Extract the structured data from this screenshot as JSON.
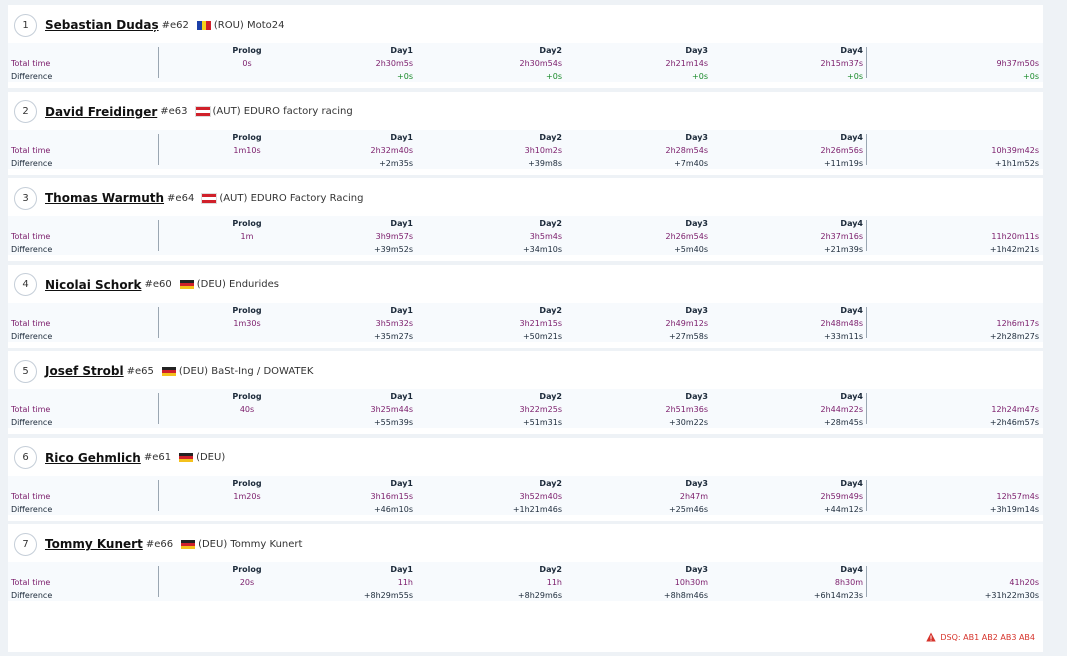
{
  "columns": {
    "prolog": "Prolog",
    "day1": "Day1",
    "day2": "Day2",
    "day3": "Day3",
    "day4": "Day4"
  },
  "row_labels": {
    "total": "Total time",
    "difference": "Difference"
  },
  "flags": {
    "ROU": {
      "dir": "v",
      "colors": [
        "#1c3fa8",
        "#f4d21c",
        "#d0202a"
      ]
    },
    "AUT": {
      "dir": "h",
      "colors": [
        "#d0202a",
        "#ffffff",
        "#d0202a"
      ]
    },
    "DEU": {
      "dir": "h",
      "colors": [
        "#222222",
        "#d0202a",
        "#f4c11c"
      ]
    }
  },
  "riders": [
    {
      "pos": "1",
      "name": "Sebastian Dudaș",
      "num": "#e62",
      "flag": "ROU",
      "team": "(ROU) Moto24",
      "total": {
        "prolog": "0s",
        "day1": "2h30m5s",
        "day2": "2h30m54s",
        "day3": "2h21m14s",
        "day4": "2h15m37s",
        "final": "9h37m50s"
      },
      "diff": {
        "prolog": "",
        "day1": "+0s",
        "day2": "+0s",
        "day3": "+0s",
        "day4": "+0s",
        "final": "+0s"
      }
    },
    {
      "pos": "2",
      "name": "David Freidinger",
      "num": "#e63",
      "flag": "AUT",
      "team": "(AUT) EDURO factory racing",
      "total": {
        "prolog": "1m10s",
        "day1": "2h32m40s",
        "day2": "3h10m2s",
        "day3": "2h28m54s",
        "day4": "2h26m56s",
        "final": "10h39m42s"
      },
      "diff": {
        "prolog": "",
        "day1": "+2m35s",
        "day2": "+39m8s",
        "day3": "+7m40s",
        "day4": "+11m19s",
        "final": "+1h1m52s"
      }
    },
    {
      "pos": "3",
      "name": "Thomas Warmuth",
      "num": "#e64",
      "flag": "AUT",
      "team": "(AUT) EDURO Factory Racing",
      "total": {
        "prolog": "1m",
        "day1": "3h9m57s",
        "day2": "3h5m4s",
        "day3": "2h26m54s",
        "day4": "2h37m16s",
        "final": "11h20m11s"
      },
      "diff": {
        "prolog": "",
        "day1": "+39m52s",
        "day2": "+34m10s",
        "day3": "+5m40s",
        "day4": "+21m39s",
        "final": "+1h42m21s"
      }
    },
    {
      "pos": "4",
      "name": "Nicolai Schork",
      "num": "#e60",
      "flag": "DEU",
      "team": "(DEU) Endurides",
      "total": {
        "prolog": "1m30s",
        "day1": "3h5m32s",
        "day2": "3h21m15s",
        "day3": "2h49m12s",
        "day4": "2h48m48s",
        "final": "12h6m17s"
      },
      "diff": {
        "prolog": "",
        "day1": "+35m27s",
        "day2": "+50m21s",
        "day3": "+27m58s",
        "day4": "+33m11s",
        "final": "+2h28m27s"
      }
    },
    {
      "pos": "5",
      "name": "Josef Strobl",
      "num": "#e65",
      "flag": "DEU",
      "team": "(DEU) BaSt-Ing / DOWATEK",
      "total": {
        "prolog": "40s",
        "day1": "3h25m44s",
        "day2": "3h22m25s",
        "day3": "2h51m36s",
        "day4": "2h44m22s",
        "final": "12h24m47s"
      },
      "diff": {
        "prolog": "",
        "day1": "+55m39s",
        "day2": "+51m31s",
        "day3": "+30m22s",
        "day4": "+28m45s",
        "final": "+2h46m57s"
      }
    },
    {
      "pos": "6",
      "name": "Rico Gehmlich",
      "num": "#e61",
      "flag": "DEU",
      "team": "(DEU)",
      "total": {
        "prolog": "1m20s",
        "day1": "3h16m15s",
        "day2": "3h52m40s",
        "day3": "2h47m",
        "day4": "2h59m49s",
        "final": "12h57m4s"
      },
      "diff": {
        "prolog": "",
        "day1": "+46m10s",
        "day2": "+1h21m46s",
        "day3": "+25m46s",
        "day4": "+44m12s",
        "final": "+3h19m14s"
      }
    },
    {
      "pos": "7",
      "name": "Tommy Kunert",
      "num": "#e66",
      "flag": "DEU",
      "team": "(DEU) Tommy Kunert",
      "total": {
        "prolog": "20s",
        "day1": "11h",
        "day2": "11h",
        "day3": "10h30m",
        "day4": "8h30m",
        "final": "41h20s"
      },
      "diff": {
        "prolog": "",
        "day1": "+8h29m55s",
        "day2": "+8h29m6s",
        "day3": "+8h8m46s",
        "day4": "+6h14m23s",
        "final": "+31h22m30s"
      },
      "dsq": "DSQ: AB1 AB2 AB3 AB4"
    }
  ]
}
